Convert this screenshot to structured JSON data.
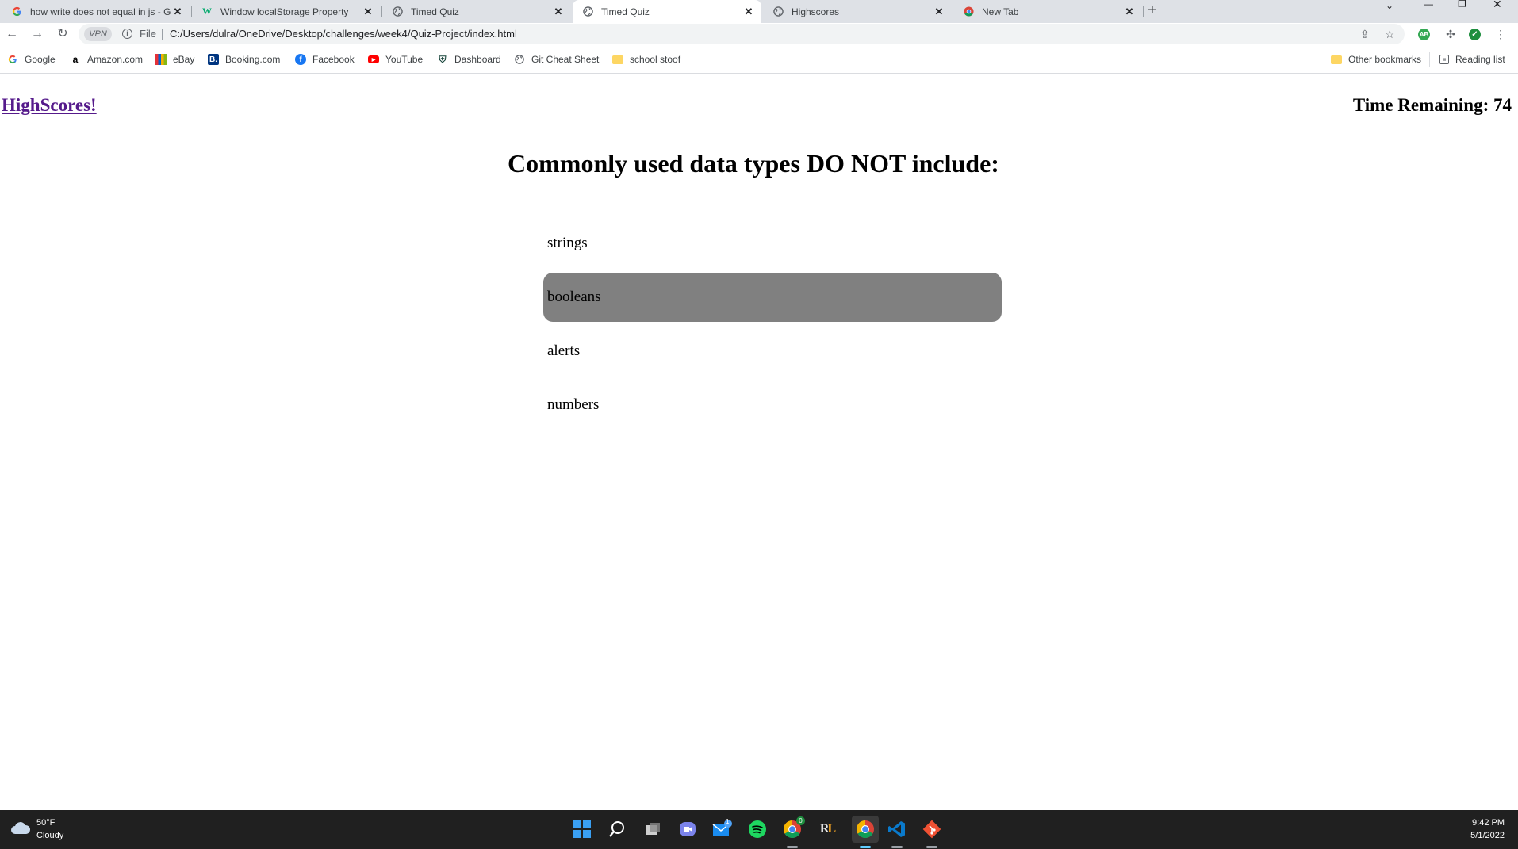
{
  "browser": {
    "tabs": [
      {
        "title": "how write does not equal in js - G",
        "favicon": "google-icon",
        "active": false
      },
      {
        "title": "Window localStorage Property",
        "favicon": "w3schools-icon",
        "active": false
      },
      {
        "title": "Timed Quiz",
        "favicon": "globe-icon",
        "active": false
      },
      {
        "title": "Timed Quiz",
        "favicon": "globe-icon",
        "active": true
      },
      {
        "title": "Highscores",
        "favicon": "globe-icon",
        "active": false
      },
      {
        "title": "New Tab",
        "favicon": "chrome-icon",
        "active": false
      }
    ],
    "new_tab_symbol": "+",
    "omnibox": {
      "vpn_label": "VPN",
      "scheme_label": "File",
      "url": "C:/Users/dulra/OneDrive/Desktop/challenges/week4/Quiz-Project/index.html"
    },
    "extensions": [
      {
        "name": "adblock-icon",
        "label": "AB",
        "color": "#34a853"
      },
      {
        "name": "shield-check-icon",
        "label": "✓",
        "color": "#1e8e3e"
      }
    ],
    "bookmarks": [
      {
        "label": "Google",
        "icon": "google-icon"
      },
      {
        "label": "Amazon.com",
        "icon": "amazon-icon"
      },
      {
        "label": "eBay",
        "icon": "ebay-icon"
      },
      {
        "label": "Booking.com",
        "icon": "booking-icon"
      },
      {
        "label": "Facebook",
        "icon": "facebook-icon"
      },
      {
        "label": "YouTube",
        "icon": "youtube-icon"
      },
      {
        "label": "Dashboard",
        "icon": "spartan-icon"
      },
      {
        "label": "Git Cheat Sheet",
        "icon": "globe-icon"
      },
      {
        "label": "school stoof",
        "icon": "folder-icon"
      }
    ],
    "other_bookmarks": "Other bookmarks",
    "reading_list": "Reading list"
  },
  "page": {
    "highscores_link": "HighScores!",
    "timer_label": "Time Remaining:",
    "timer_value": "74",
    "question": "Commonly used data types DO NOT include:",
    "answers": [
      "strings",
      "booleans",
      "alerts",
      "numbers"
    ],
    "hovered_answer_index": 1,
    "hover_color": "#808080",
    "link_color": "#551a8b"
  },
  "taskbar": {
    "weather_temp": "50°F",
    "weather_desc": "Cloudy",
    "mail_badge": "1",
    "chrome_badge": "0",
    "time": "9:42 PM",
    "date": "5/1/2022"
  }
}
